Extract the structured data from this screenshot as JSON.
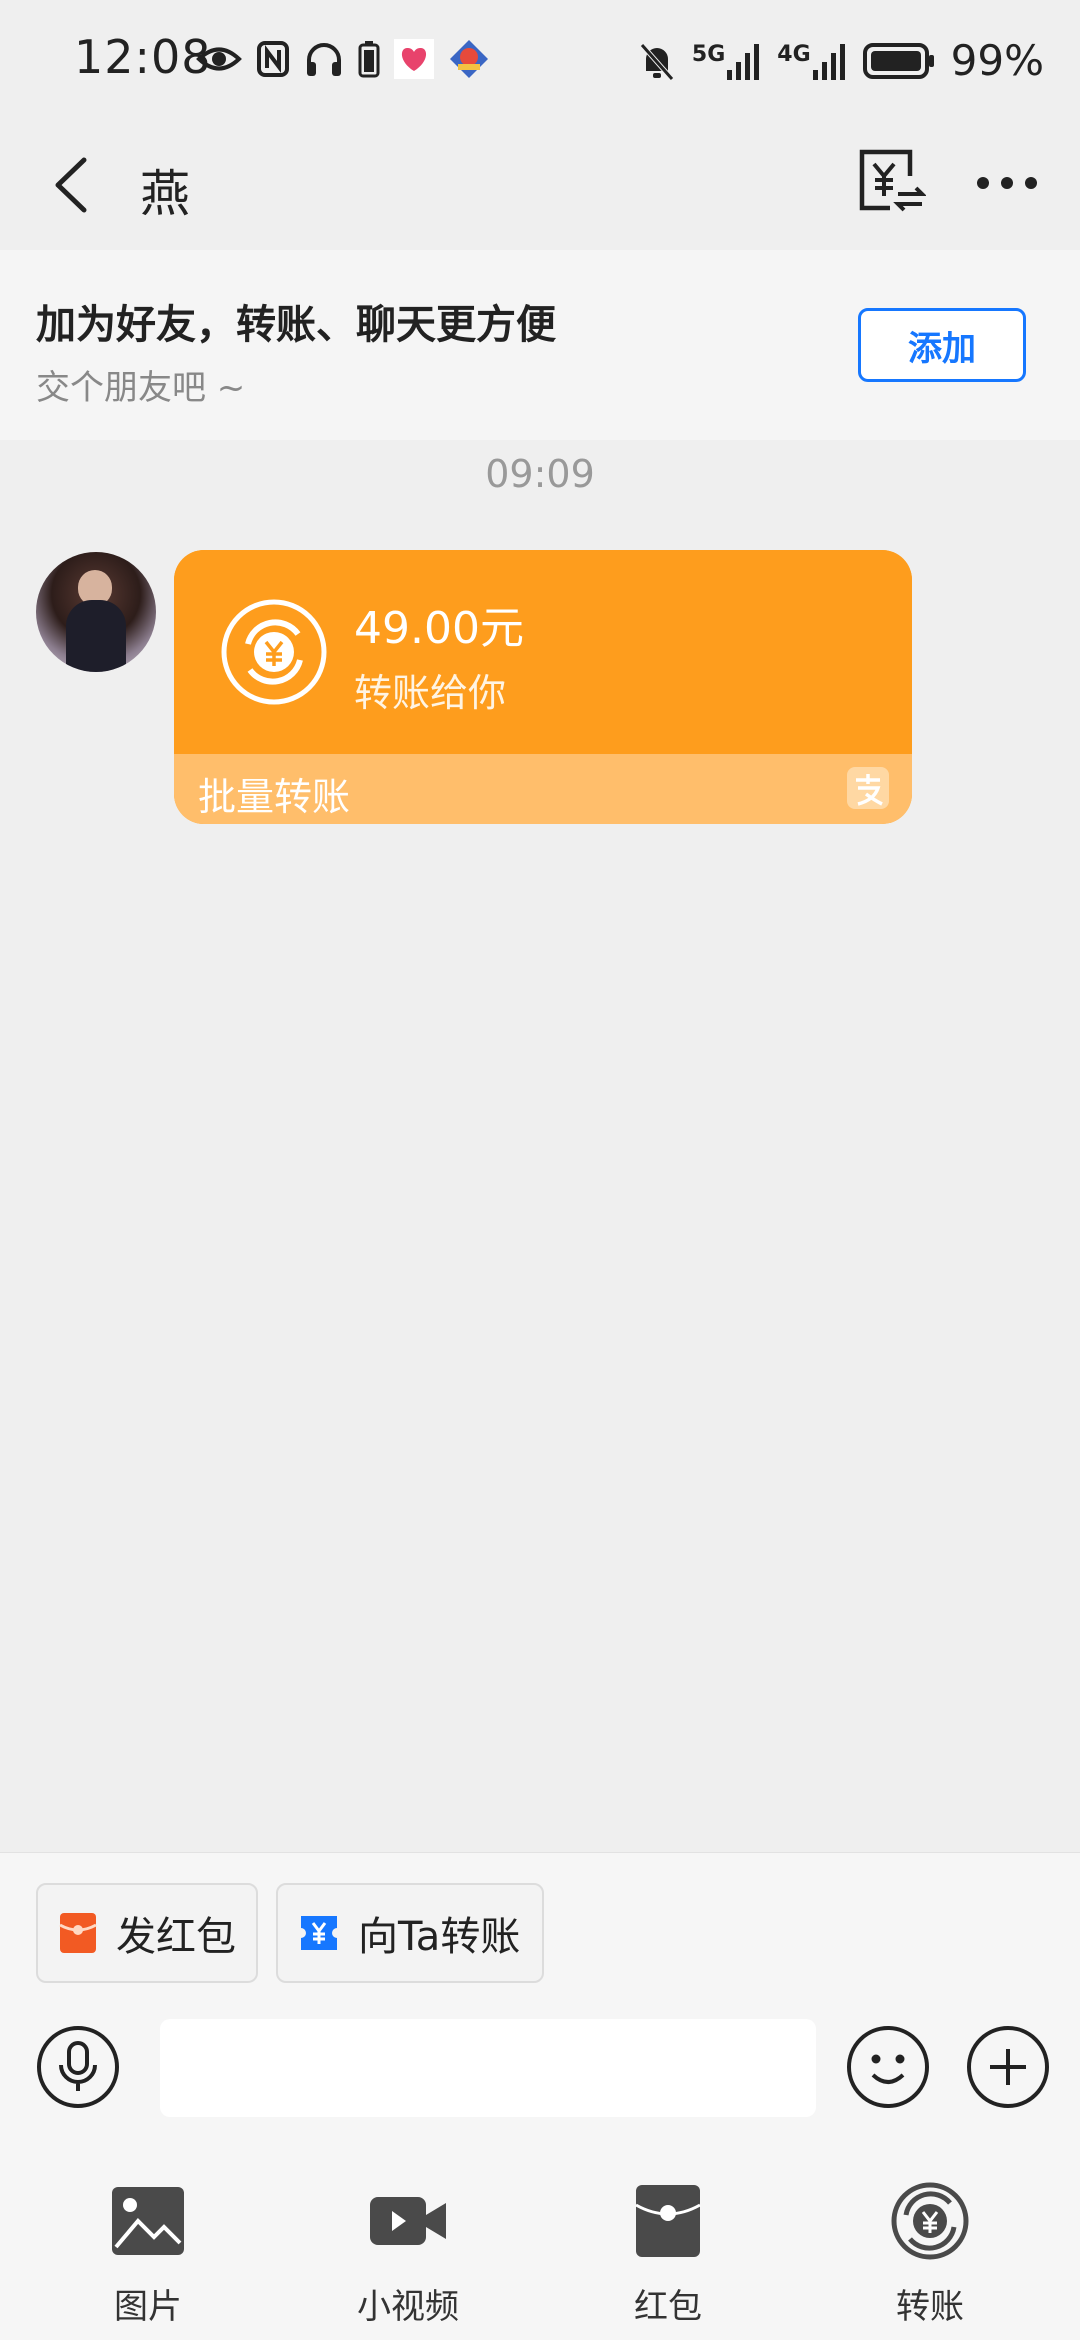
{
  "status_bar": {
    "time": "12:08",
    "network_5g": "5G",
    "network_4g": "4G",
    "battery": "99%"
  },
  "header": {
    "title": "燕"
  },
  "friend_banner": {
    "title": "加为好友，转账、聊天更方便",
    "subtitle": "交个朋友吧 ~",
    "add_label": "添加"
  },
  "chat": {
    "timestamp": "09:09",
    "transfer_card": {
      "amount": "49.00元",
      "description": "转账给你",
      "footer": "批量转账"
    }
  },
  "composer": {
    "quick_actions": [
      {
        "label": "发红包"
      },
      {
        "label": "向Ta转账"
      }
    ],
    "input_placeholder": "",
    "tools": [
      {
        "label": "图片"
      },
      {
        "label": "小视频"
      },
      {
        "label": "红包"
      },
      {
        "label": "转账"
      }
    ]
  },
  "colors": {
    "card_orange": "#fe9d1d",
    "card_footer": "#ffbe6b",
    "accent_blue": "#1677ff",
    "redpacket_red": "#f25a23"
  }
}
